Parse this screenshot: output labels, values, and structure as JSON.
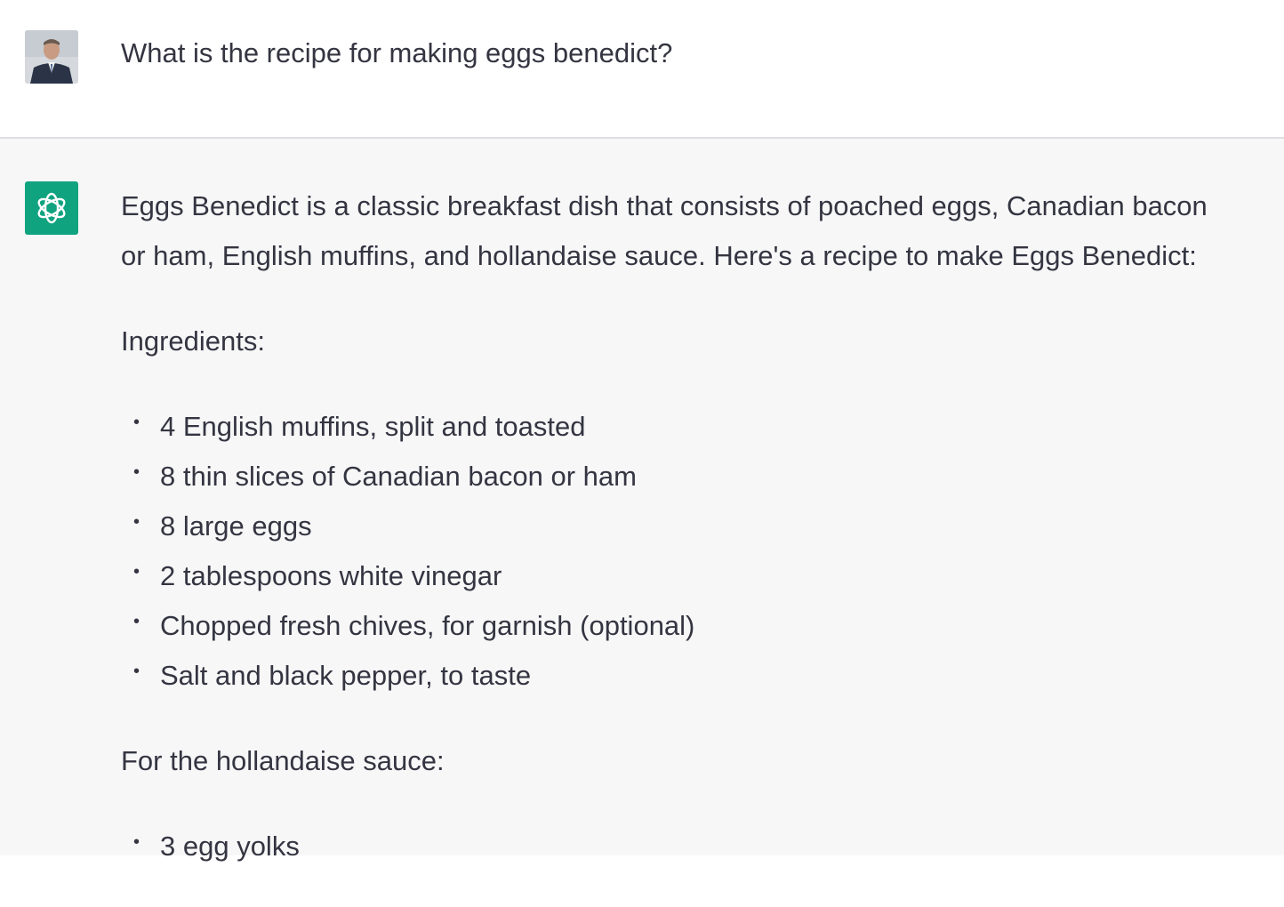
{
  "user_message": {
    "text": "What is the recipe for making eggs benedict?",
    "avatar_icon": "user-photo"
  },
  "assistant_message": {
    "avatar_icon": "openai-logo-icon",
    "avatar_color": "#10a37f",
    "intro_line1": "Eggs Benedict is a classic breakfast dish that consists of poached eggs, Canadian bacon",
    "intro_line2": "or ham, English muffins, and hollandaise sauce. Here's a recipe to make Eggs Benedict:",
    "ingredients_heading": "Ingredients:",
    "ingredients": [
      "4 English muffins, split and toasted",
      "8 thin slices of Canadian bacon or ham",
      "8 large eggs",
      "2 tablespoons white vinegar",
      "Chopped fresh chives, for garnish (optional)",
      "Salt and black pepper, to taste"
    ],
    "sauce_heading": "For the hollandaise sauce:",
    "sauce_ingredients": [
      "3 egg yolks"
    ]
  }
}
